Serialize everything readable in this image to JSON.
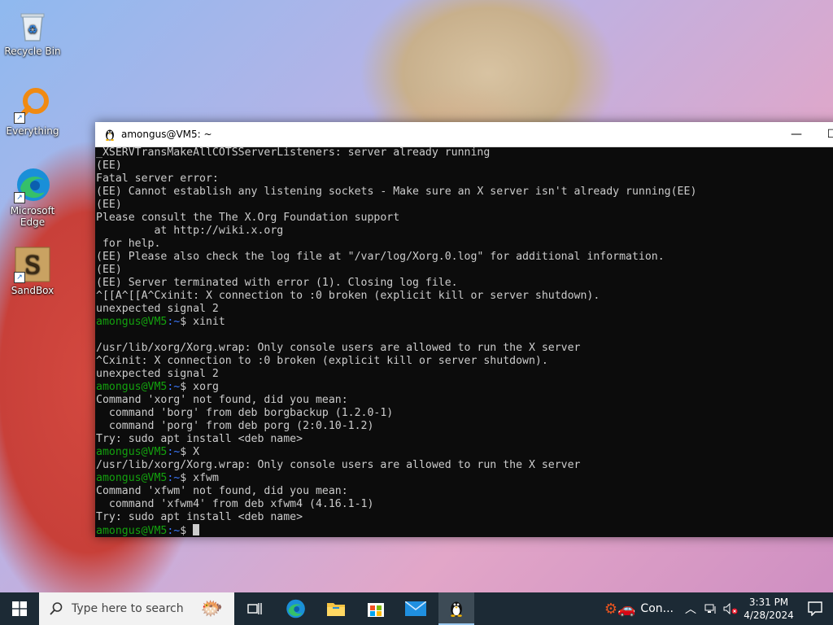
{
  "desktop": {
    "icons": [
      {
        "label": "Recycle Bin",
        "icon": "recycle-bin-icon"
      },
      {
        "label": "Everything",
        "icon": "magnifier-icon"
      },
      {
        "label": "Microsoft Edge",
        "icon": "edge-icon"
      },
      {
        "label": "SandBox",
        "icon": "sandbox-icon"
      }
    ]
  },
  "terminal": {
    "title": "amongus@VM5: ~",
    "prompt_user": "amongus@VM5",
    "prompt_path": ":~",
    "prompt_symbol": "$",
    "lines": [
      {
        "type": "out",
        "text": "_XSERVTransMakeAllCOTSServerListeners: server already running"
      },
      {
        "type": "out",
        "text": "(EE)"
      },
      {
        "type": "out",
        "text": "Fatal server error:"
      },
      {
        "type": "out",
        "text": "(EE) Cannot establish any listening sockets - Make sure an X server isn't already running(EE)"
      },
      {
        "type": "out",
        "text": "(EE)"
      },
      {
        "type": "out",
        "text": "Please consult the The X.Org Foundation support"
      },
      {
        "type": "out",
        "text": "         at http://wiki.x.org"
      },
      {
        "type": "out",
        "text": " for help."
      },
      {
        "type": "out",
        "text": "(EE) Please also check the log file at \"/var/log/Xorg.0.log\" for additional information."
      },
      {
        "type": "out",
        "text": "(EE)"
      },
      {
        "type": "out",
        "text": "(EE) Server terminated with error (1). Closing log file."
      },
      {
        "type": "out",
        "text": "^[[A^[[A^Cxinit: X connection to :0 broken (explicit kill or server shutdown)."
      },
      {
        "type": "out",
        "text": "unexpected signal 2"
      },
      {
        "type": "cmd",
        "text": " xinit"
      },
      {
        "type": "out",
        "text": ""
      },
      {
        "type": "out",
        "text": "/usr/lib/xorg/Xorg.wrap: Only console users are allowed to run the X server"
      },
      {
        "type": "out",
        "text": "^Cxinit: X connection to :0 broken (explicit kill or server shutdown)."
      },
      {
        "type": "out",
        "text": "unexpected signal 2"
      },
      {
        "type": "cmd",
        "text": " xorg"
      },
      {
        "type": "out",
        "text": "Command 'xorg' not found, did you mean:"
      },
      {
        "type": "out",
        "text": "  command 'borg' from deb borgbackup (1.2.0-1)"
      },
      {
        "type": "out",
        "text": "  command 'porg' from deb porg (2:0.10-1.2)"
      },
      {
        "type": "out",
        "text": "Try: sudo apt install <deb name>"
      },
      {
        "type": "cmd",
        "text": " X"
      },
      {
        "type": "out",
        "text": "/usr/lib/xorg/Xorg.wrap: Only console users are allowed to run the X server"
      },
      {
        "type": "cmd",
        "text": " xfwm"
      },
      {
        "type": "out",
        "text": "Command 'xfwm' not found, did you mean:"
      },
      {
        "type": "out",
        "text": "  command 'xfwm4' from deb xfwm4 (4.16.1-1)"
      },
      {
        "type": "out",
        "text": "Try: sudo apt install <deb name>"
      },
      {
        "type": "cmd",
        "text": " "
      }
    ]
  },
  "taskbar": {
    "search_placeholder": "Type here to search",
    "pinned": [
      "task-view-icon",
      "edge-icon",
      "file-explorer-icon",
      "microsoft-store-icon",
      "mail-icon",
      "tux-icon"
    ],
    "notification_label": "Con...",
    "time": "3:31 PM",
    "date": "4/28/2024"
  },
  "colors": {
    "prompt_user": "#13a10e",
    "prompt_path": "#3b78ff",
    "terminal_bg": "#0c0c0c",
    "terminal_fg": "#cccccc",
    "taskbar_bg": "#1c2a35"
  }
}
